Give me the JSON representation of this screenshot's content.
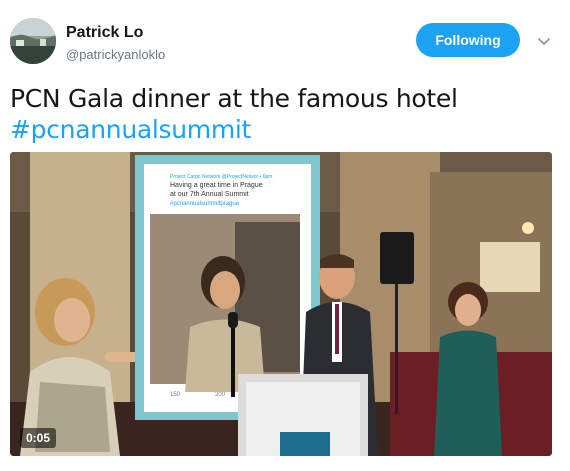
{
  "author": {
    "display_name": "Patrick Lo",
    "handle": "@patrickyanloklo"
  },
  "follow_button": {
    "label": "Following",
    "color": "#1da1f2"
  },
  "menu_icon": "chevron-down-icon",
  "tweet": {
    "text": "PCN Gala dinner at the famous hotel",
    "hashtag": "#pcnannualsummit"
  },
  "media": {
    "type": "video",
    "duration": "0:05",
    "frame_prop": {
      "account_line": "Project Cargo Network @ProjectNetwor • 6pm",
      "line1": "Having a great time in Prague",
      "line2": "at our 7th Annual Summit",
      "line3": "#pcnannualsummitprague",
      "stat_retweets": "150",
      "stat_likes": "200"
    }
  }
}
